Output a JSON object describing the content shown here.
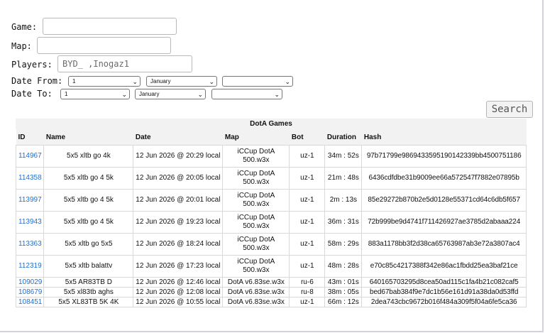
{
  "form": {
    "game_label": "Game:",
    "map_label": "Map:",
    "players_label": "Players:",
    "players_value": "BYD_ ,Inogaz1",
    "date_from_label": "Date From:",
    "date_to_label": "Date To:",
    "from_day": "1",
    "from_month": "January",
    "from_year": "",
    "to_day": "1",
    "to_month": "January",
    "to_year": "",
    "search_label": "Search"
  },
  "table": {
    "caption": "DotA Games",
    "headers": [
      "ID",
      "Name",
      "Date",
      "Map",
      "Bot",
      "Duration",
      "Hash"
    ],
    "rows": [
      {
        "id": "114967",
        "name": "5x5 xltb go 4k",
        "date": "12 Jun 2026 @ 20:29 local",
        "map": "iCCup DotA 500.w3x",
        "bot": "uz-1",
        "duration": "34m : 52s",
        "hash": "97b71799e986943359519014233 9bb4500751186"
      },
      {
        "id": "114358",
        "name": "5x5 xltb go 4 5k",
        "date": "12 Jun 2026 @ 20:05 local",
        "map": "iCCup DotA 500.w3x",
        "bot": "uz-1",
        "duration": "21m : 48s",
        "hash": "6436cdfdbe31b9009ee66a572547f7882e07895b"
      },
      {
        "id": "113997",
        "name": "5x5 xltb go 4 5k",
        "date": "12 Jun 2026 @ 20:01 local",
        "map": "iCCup DotA 500.w3x",
        "bot": "uz-1",
        "duration": "2m : 13s",
        "hash": "85e29272b870b2e5d0128e55371cd64c6db5f657"
      },
      {
        "id": "113943",
        "name": "5x5 xltb go 4 5k",
        "date": "12 Jun 2026 @ 19:23 local",
        "map": "iCCup DotA 500.w3x",
        "bot": "uz-1",
        "duration": "36m : 31s",
        "hash": "72b999be9d4741f711426927ae3785d2abaaa224"
      },
      {
        "id": "113363",
        "name": "5x5 xltb go 5x5",
        "date": "12 Jun 2026 @ 18:24 local",
        "map": "iCCup DotA 500.w3x",
        "bot": "uz-1",
        "duration": "58m : 29s",
        "hash": "883a1178bb3f2d38ca65763987ab3e72a3807ac4"
      },
      {
        "id": "112319",
        "name": "5x5 xltb balattv",
        "date": "12 Jun 2026 @ 17:23 local",
        "map": "iCCup DotA 500.w3x",
        "bot": "uz-1",
        "duration": "48m : 28s",
        "hash": "e70c85c4217388f342e86ac1fbdd25ea3baf21ce"
      },
      {
        "id": "109029",
        "name": "5x5 AR83TB D",
        "date": "12 Jun 2026 @ 12:46 local",
        "map": "DotA v6.83se.w3x",
        "bot": "ru-6",
        "duration": "43m : 01s",
        "hash": "640165703295d8cea50ad115c1fa4b21c082caf5"
      },
      {
        "id": "108679",
        "name": "5x5 xl83tb aghs",
        "date": "12 Jun 2026 @ 12:08 local",
        "map": "DotA v6.83se.w3x",
        "bot": "ru-8",
        "duration": "38m : 05s",
        "hash": "bed67bab384f9e7dc1b56e161d91a38da0d53ffd"
      },
      {
        "id": "108451",
        "name": "5x5 XL83TB 5K 4K",
        "date": "12 Jun 2026 @ 10:55 local",
        "map": "DotA v6.83se.w3x",
        "bot": "uz-1",
        "duration": "66m : 12s",
        "hash": "2dea743cbc9672b016f484a309f5f04a6fe5ca36"
      }
    ]
  }
}
